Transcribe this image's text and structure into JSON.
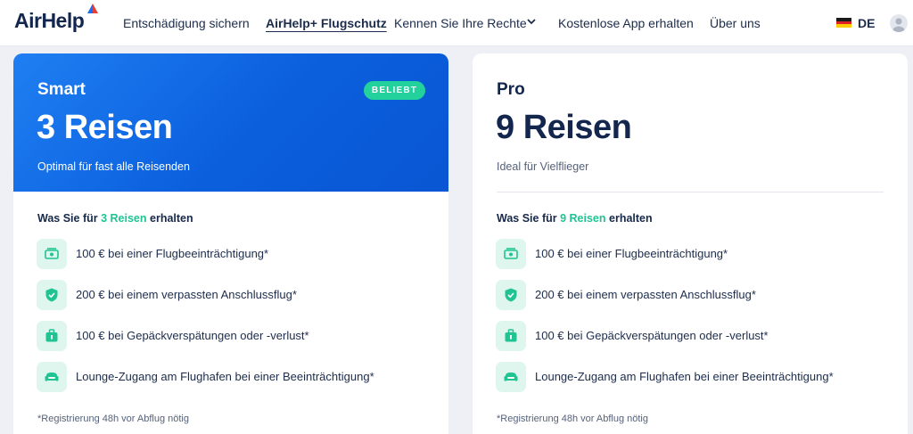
{
  "header": {
    "logo": "AirHelp",
    "nav": [
      {
        "label": "Entschädigung sichern"
      },
      {
        "label": "AirHelp+ Flugschutz"
      },
      {
        "label": "Kennen Sie Ihre Rechte"
      },
      {
        "label": "Kostenlose App erhalten"
      },
      {
        "label": "Über uns"
      }
    ],
    "language": "DE"
  },
  "plans": [
    {
      "name": "Smart",
      "badge": "BELIEBT",
      "trips": "3 Reisen",
      "subtitle": "Optimal für fast alle Reisenden",
      "what_prefix": "Was Sie für",
      "what_highlight": "3 Reisen",
      "what_suffix": "erhalten",
      "features": [
        {
          "label": "100 € bei einer Flugbeeinträchtigung*",
          "icon": "money-icon"
        },
        {
          "label": "200 € bei einem verpassten Anschlussflug*",
          "icon": "shield-icon"
        },
        {
          "label": "100 € bei Gepäckverspätungen oder -verlust*",
          "icon": "luggage-icon"
        },
        {
          "label": "Lounge-Zugang am Flughafen bei einer Beeinträchtigung*",
          "icon": "lounge-icon"
        }
      ],
      "footnote": "*Registrierung 48h vor Abflug nötig"
    },
    {
      "name": "Pro",
      "trips": "9 Reisen",
      "subtitle": "Ideal für Vielflieger",
      "what_prefix": "Was Sie für",
      "what_highlight": "9 Reisen",
      "what_suffix": "erhalten",
      "features": [
        {
          "label": "100 € bei einer Flugbeeinträchtigung*",
          "icon": "money-icon"
        },
        {
          "label": "200 € bei einem verpassten Anschlussflug*",
          "icon": "shield-icon"
        },
        {
          "label": "100 € bei Gepäckverspätungen oder -verlust*",
          "icon": "luggage-icon"
        },
        {
          "label": "Lounge-Zugang am Flughafen bei einer Beeinträchtigung*",
          "icon": "lounge-icon"
        }
      ],
      "footnote": "*Registrierung 48h vor Abflug nötig"
    }
  ],
  "colors": {
    "brand_blue": "#0b5fdd",
    "accent_green": "#1fc492",
    "navy": "#13264d",
    "icon_bg": "#dff6ee"
  }
}
